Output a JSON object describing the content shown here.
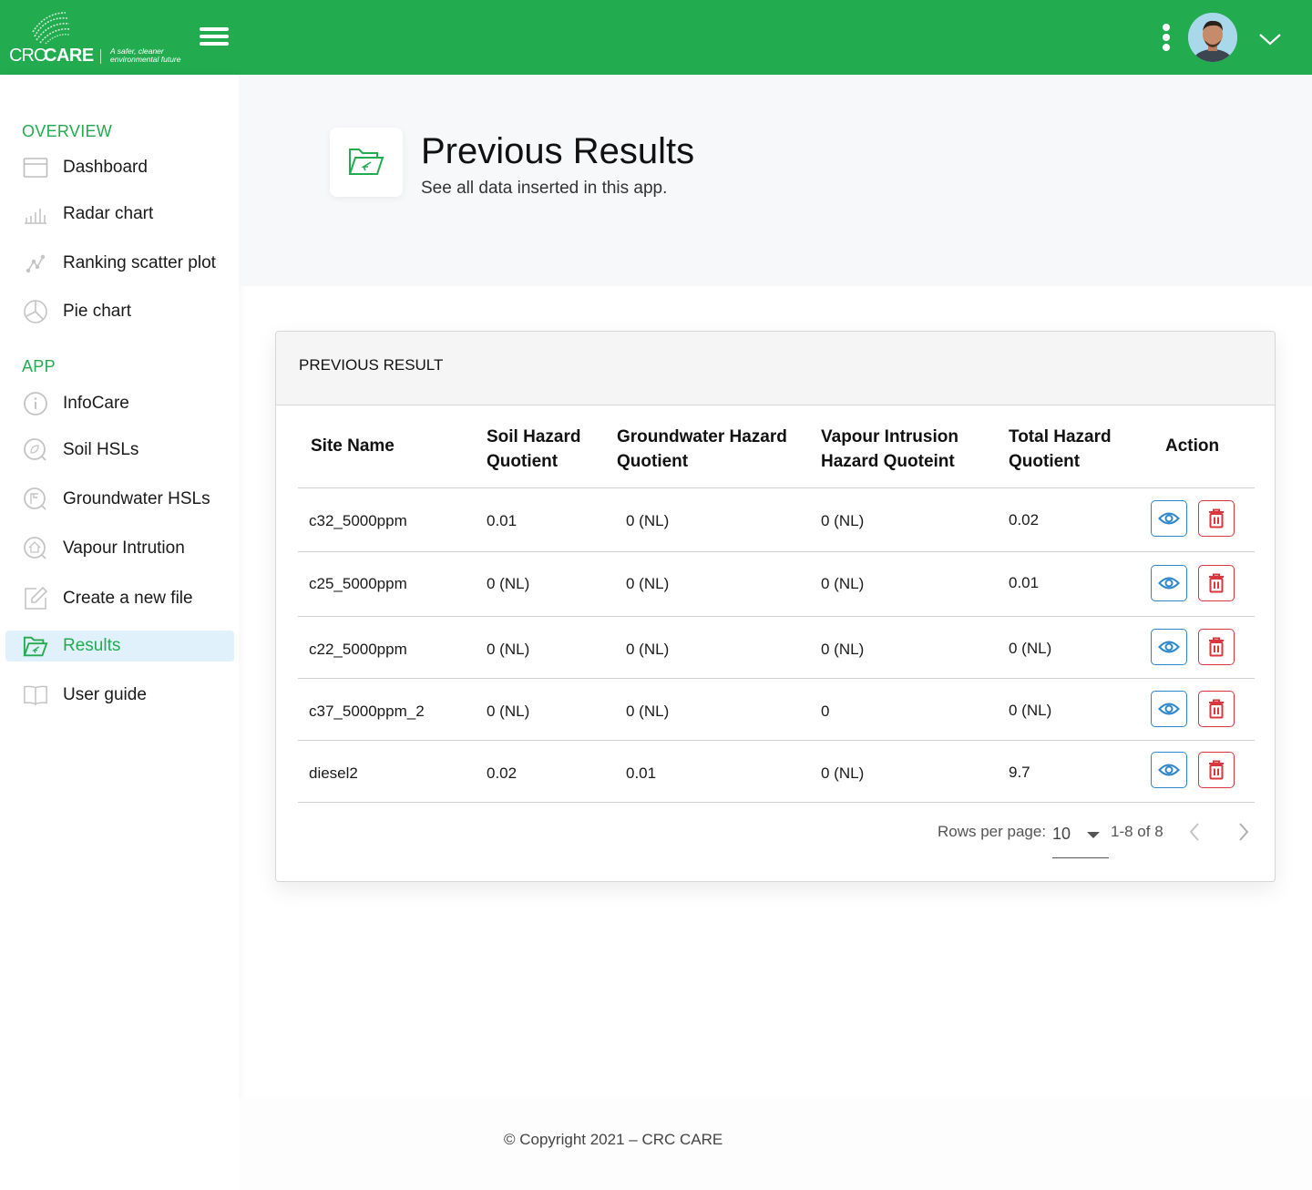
{
  "header": {
    "logo": {
      "left_text": "CRC",
      "right_text": "CARE",
      "tagline": "A safer, cleaner environmental future"
    },
    "menu_icon": "hamburger-icon",
    "more_icon": "kebab-menu-icon",
    "profile_icon": "chevron-down-icon",
    "brand_color": "#22ab4f"
  },
  "sidebar": {
    "sections": [
      {
        "label": "OVERVIEW"
      },
      {
        "label": "APP"
      }
    ],
    "items": [
      {
        "label": "Dashboard",
        "icon": "dashboard-icon"
      },
      {
        "label": "Radar chart",
        "icon": "bar-chart-icon"
      },
      {
        "label": "Ranking scatter plot",
        "icon": "scatter-plot-icon"
      },
      {
        "label": "Pie chart",
        "icon": "pie-chart-icon"
      },
      {
        "label": "InfoCare",
        "icon": "info-icon"
      },
      {
        "label": "Soil HSLs",
        "icon": "soil-search-icon"
      },
      {
        "label": "Groundwater HSLs",
        "icon": "groundwater-search-icon"
      },
      {
        "label": "Vapour Intrution",
        "icon": "vapour-search-icon"
      },
      {
        "label": "Create a new file",
        "icon": "edit-file-icon"
      },
      {
        "label": "Results",
        "icon": "folder-open-icon",
        "active": true
      },
      {
        "label": "User guide",
        "icon": "book-icon"
      }
    ],
    "active_color": "#22ab4f",
    "active_bg": "#e1f1fc"
  },
  "page": {
    "title": "Previous Results",
    "subtitle": "See all data inserted in this app."
  },
  "card": {
    "title": "PREVIOUS RESULT",
    "columns": [
      {
        "line1": "Site Name",
        "line2": ""
      },
      {
        "line1": "Soil Hazard",
        "line2": "Quotient"
      },
      {
        "line1": "Groundwater Hazard",
        "line2": "Quotient"
      },
      {
        "line1": "Vapour Intrusion",
        "line2": "Hazard Quoteint"
      },
      {
        "line1": "Total Hazard",
        "line2": "Quotient"
      },
      {
        "line1": "Action",
        "line2": ""
      }
    ],
    "rows": [
      {
        "site": "c32_5000ppm",
        "soil": "0.01",
        "groundwater": "0 (NL)",
        "vapour": "0 (NL)",
        "total": "0.02"
      },
      {
        "site": "c25_5000ppm",
        "soil": "0 (NL)",
        "groundwater": "0 (NL)",
        "vapour": "0 (NL)",
        "total": "0.01"
      },
      {
        "site": "c22_5000ppm",
        "soil": "0 (NL)",
        "groundwater": "0 (NL)",
        "vapour": "0 (NL)",
        "total": "0 (NL)"
      },
      {
        "site": "c37_5000ppm_2",
        "soil": "0 (NL)",
        "groundwater": "0 (NL)",
        "vapour": "0",
        "total": "0 (NL)"
      },
      {
        "site": "diesel2",
        "soil": "0.02",
        "groundwater": "0.01",
        "vapour": "0 (NL)",
        "total": "9.7"
      }
    ],
    "actions": {
      "view_icon": "eye-icon",
      "delete_icon": "trash-icon",
      "view_color": "#2f86c9",
      "delete_color": "#d9363e"
    },
    "pagination": {
      "rows_per_page_label": "Rows per page:",
      "rows_per_page_value": "10",
      "range": "1-8 of 8"
    }
  },
  "footer": {
    "text": "© Copyright 2021 – CRC CARE"
  }
}
